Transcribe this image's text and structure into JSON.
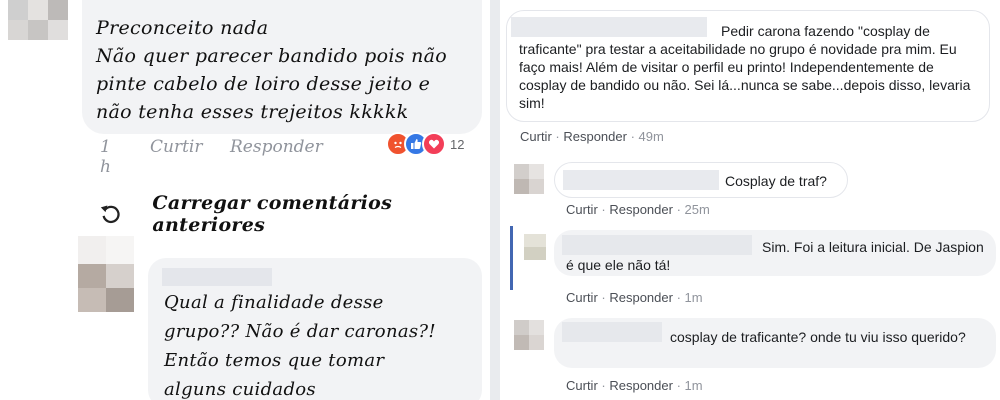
{
  "left": {
    "comment1": {
      "lines": [
        "Preconceito nada",
        "Não quer parecer bandido pois não",
        "pinte cabelo de loiro desse jeito e",
        "não tenha esses trejeitos  kkkkk"
      ],
      "time": "1 h",
      "like_label": "Curtir",
      "reply_label": "Responder",
      "reaction_count": "12",
      "reactions": [
        "angry-reaction-icon",
        "like-reaction-icon",
        "love-reaction-icon"
      ]
    },
    "load_more_label": "Carregar comentários anteriores",
    "comment2": {
      "lines": [
        "Qual a finalidade desse",
        "grupo?? Não é dar caronas?!",
        "Então temos  que tomar",
        "alguns cuidados"
      ]
    }
  },
  "right": {
    "comments": [
      {
        "text": "Pedir carona fazendo \"cosplay de traficante\" pra testar a aceitabilidade no grupo é novidade pra mim. Eu faço mais! Além de visitar o perfil eu printo! Independentemente de cosplay de bandido ou não. Sei lá...nunca se sabe...depois disso, levaria sim!",
        "like_label": "Curtir",
        "reply_label": "Responder",
        "time": "49m"
      },
      {
        "text": "Cosplay de traf?",
        "like_label": "Curtir",
        "reply_label": "Responder",
        "time": "25m"
      },
      {
        "text": "Sim. Foi a leitura inicial. De Jaspion é que ele não tá!",
        "like_label": "Curtir",
        "reply_label": "Responder",
        "time": "1m"
      },
      {
        "text": "cosplay de traficante? onde tu viu isso querido?",
        "like_label": "Curtir",
        "reply_label": "Responder",
        "time": "1m"
      }
    ],
    "separator": " · "
  },
  "colors": {
    "bubble": "#f2f3f5",
    "meta": "#90949c",
    "thread_line": "#4267b2",
    "divider": "#e9ebee"
  }
}
